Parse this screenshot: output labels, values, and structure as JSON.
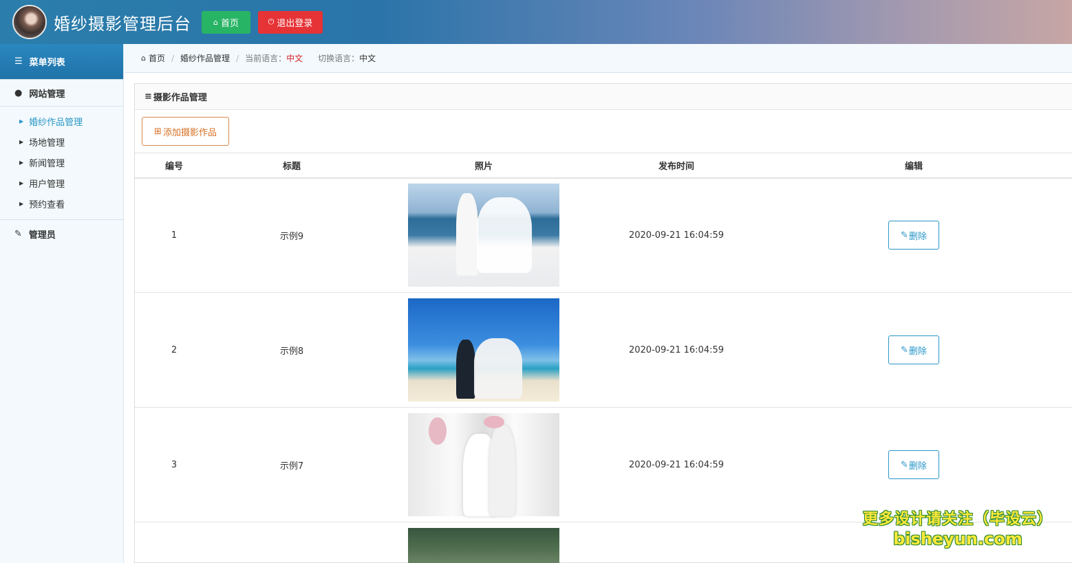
{
  "header": {
    "site_title": "婚纱摄影管理后台",
    "home_button": "首页",
    "logout_button": "退出登录"
  },
  "sidebar": {
    "menu_title": "菜单列表",
    "groups": [
      {
        "title": "网站管理",
        "items": [
          {
            "label": "婚纱作品管理",
            "active": true
          },
          {
            "label": "场地管理",
            "active": false
          },
          {
            "label": "新闻管理",
            "active": false
          },
          {
            "label": "用户管理",
            "active": false
          },
          {
            "label": "预约查看",
            "active": false
          }
        ]
      },
      {
        "title": "管理员",
        "items": []
      }
    ]
  },
  "breadcrumb": {
    "home": "首页",
    "current": "婚纱作品管理",
    "lang_label": "当前语言：",
    "lang_value": "中文",
    "switch_label": "切换语言：",
    "switch_value": "中文"
  },
  "panel": {
    "title": "摄影作品管理",
    "add_button": "添加摄影作品",
    "columns": [
      "编号",
      "标题",
      "照片",
      "发布时间",
      "编辑"
    ],
    "rows": [
      {
        "id": "1",
        "title": "示例9",
        "time": "2020-09-21 16:04:59",
        "action": "删除"
      },
      {
        "id": "2",
        "title": "示例8",
        "time": "2020-09-21 16:04:59",
        "action": "删除"
      },
      {
        "id": "3",
        "title": "示例7",
        "time": "2020-09-21 16:04:59",
        "action": "删除"
      }
    ]
  },
  "watermark": {
    "line1": "更多设计请关注（毕设云）",
    "line2": "bisheyun.com"
  },
  "colors": {
    "header_start": "#2b7eab",
    "home_green": "#28b465",
    "logout_red": "#e53336",
    "active_blue": "#2a96c8",
    "add_orange": "#d56f22"
  }
}
